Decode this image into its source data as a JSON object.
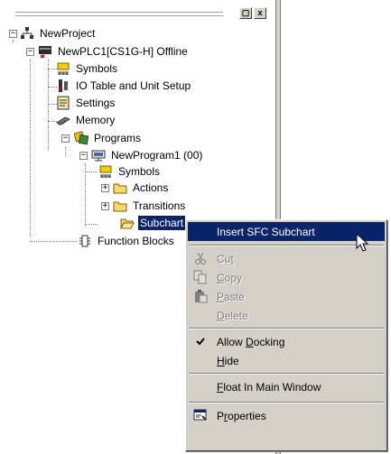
{
  "pane": {
    "title_buttons": [
      "▢",
      "x"
    ]
  },
  "tree": {
    "nodes": [
      {
        "label": "NewProject",
        "icon": "network-icon",
        "expander": "−"
      },
      {
        "label": "NewPLC1[CS1G-H] Offline",
        "icon": "plc-offline-icon",
        "expander": "−"
      },
      {
        "label": "Symbols",
        "icon": "symbols-icon"
      },
      {
        "label": "IO Table and Unit Setup",
        "icon": "io-table-icon"
      },
      {
        "label": "Settings",
        "icon": "settings-icon"
      },
      {
        "label": "Memory",
        "icon": "memory-icon"
      },
      {
        "label": "Programs",
        "icon": "programs-icon",
        "expander": "−"
      },
      {
        "label": "NewProgram1 (00)",
        "icon": "program-icon",
        "expander": "−"
      },
      {
        "label": "Symbols",
        "icon": "symbols-icon"
      },
      {
        "label": "Actions",
        "icon": "folder-icon",
        "expander": "+"
      },
      {
        "label": "Transitions",
        "icon": "folder-icon",
        "expander": "+"
      },
      {
        "label": "Subchart",
        "icon": "folder-open-icon",
        "selected": true
      },
      {
        "label": "Function Blocks",
        "icon": "function-blocks-icon"
      }
    ]
  },
  "context_menu": {
    "items": [
      {
        "label": "Insert SFC Subchart",
        "highlighted": true
      },
      {
        "label": "Cut",
        "mnemonic": "t",
        "icon": "scissors-icon",
        "disabled": true
      },
      {
        "label": "Copy",
        "mnemonic": "C",
        "icon": "copy-icon",
        "disabled": true
      },
      {
        "label": "Paste",
        "mnemonic": "P",
        "icon": "paste-icon",
        "disabled": true
      },
      {
        "label": "Delete",
        "mnemonic": "D",
        "disabled": true
      },
      {
        "label": "Allow Docking",
        "mnemonic": "D",
        "checked": true
      },
      {
        "label": "Hide",
        "mnemonic": "H"
      },
      {
        "label": "Float In Main Window",
        "mnemonic": "F"
      },
      {
        "label": "Properties",
        "mnemonic": "r",
        "icon": "properties-icon"
      }
    ]
  },
  "colors": {
    "selection": "#0a246a",
    "menu_face": "#d4d0c8",
    "disabled_text": "#808080"
  }
}
